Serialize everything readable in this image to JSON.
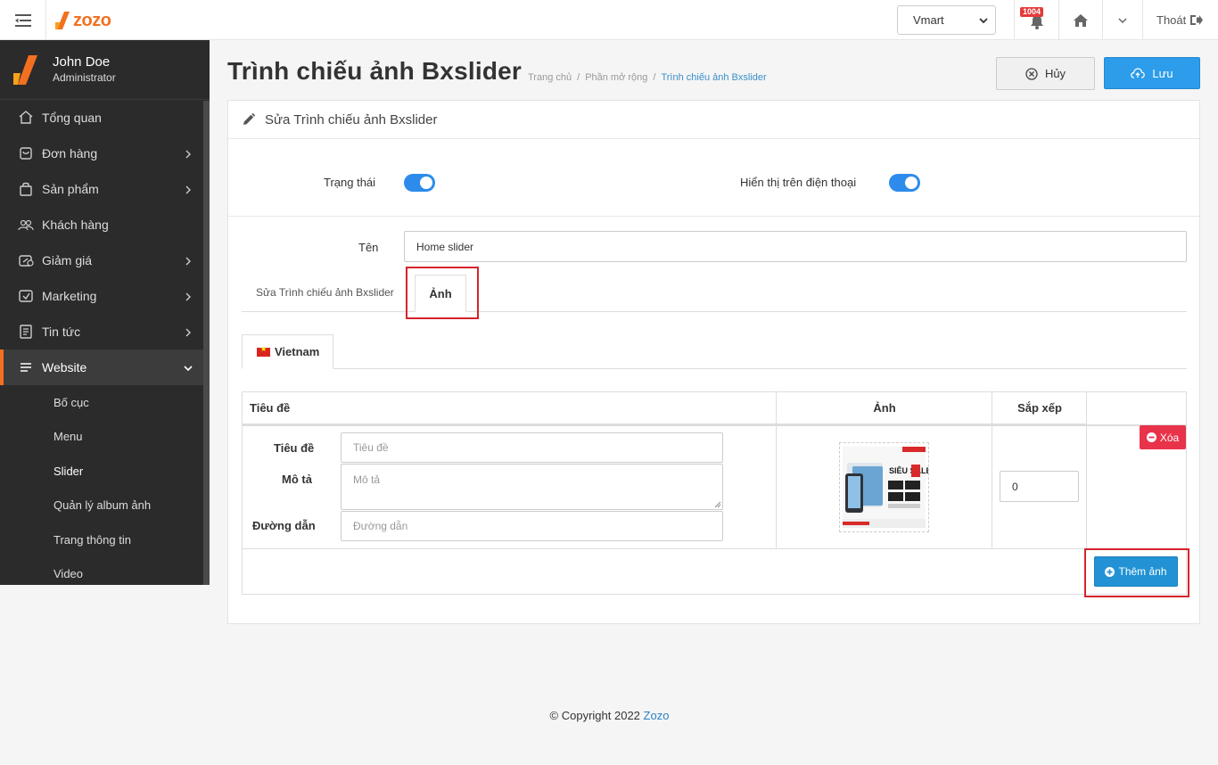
{
  "topbar": {
    "logo_text": "zozo",
    "store_selected": "Vmart",
    "notification_count": "1004",
    "logout_label": "Thoát"
  },
  "sidebar": {
    "user_name": "John Doe",
    "user_role": "Administrator",
    "items": [
      {
        "label": "Tổng quan",
        "icon": "home-icon",
        "has_children": false
      },
      {
        "label": "Đơn hàng",
        "icon": "order-icon",
        "has_children": true
      },
      {
        "label": "Sản phẩm",
        "icon": "bag-icon",
        "has_children": true
      },
      {
        "label": "Khách hàng",
        "icon": "users-icon",
        "has_children": false
      },
      {
        "label": "Giảm giá",
        "icon": "discount-icon",
        "has_children": true
      },
      {
        "label": "Marketing",
        "icon": "marketing-icon",
        "has_children": true
      },
      {
        "label": "Tin tức",
        "icon": "news-icon",
        "has_children": true
      },
      {
        "label": "Website",
        "icon": "list-icon",
        "has_children": true,
        "active": true
      }
    ],
    "sub_items": [
      "Bố cục",
      "Menu",
      "Slider",
      "Quản lý album ảnh",
      "Trang thông tin",
      "Video"
    ],
    "current_sub": "Slider"
  },
  "header": {
    "title": "Trình chiếu ảnh Bxslider",
    "breadcrumb": [
      "Trang chủ",
      "/",
      "Phần mở rộng",
      "/",
      "Trình chiếu ảnh Bxslider"
    ],
    "cancel_label": "Hủy",
    "save_label": "Lưu"
  },
  "panel": {
    "title": "Sửa Trình chiếu ảnh Bxslider",
    "status_label": "Trạng thái",
    "status_on": true,
    "mobile_label": "Hiển thị trên điện thoại",
    "mobile_on": true,
    "name_label": "Tên",
    "name_value": "Home slider",
    "tabs": [
      "Sửa Trình chiếu ảnh Bxslider",
      "Ảnh"
    ],
    "active_tab": "Ảnh",
    "language_tab": "Vietnam"
  },
  "table": {
    "headers": [
      "Tiêu đề",
      "Ảnh",
      "Sắp xếp"
    ],
    "row": {
      "title_label": "Tiêu đề",
      "title_placeholder": "Tiêu đề",
      "desc_label": "Mô tả",
      "desc_placeholder": "Mô tả",
      "link_label": "Đường dẫn",
      "link_placeholder": "Đường dẫn",
      "sort_value": "0",
      "delete_label": "Xóa",
      "banner_text": "SIÊU SALE"
    },
    "add_label": "Thêm ảnh"
  },
  "footer": {
    "copyright": "© Copyright 2022",
    "brand": "Zozo"
  },
  "colors": {
    "accent": "#2d9cea",
    "brand": "#f37021",
    "danger": "#e8334a",
    "sidebar_bg": "#2b2b2b",
    "highlight": "#d6232b"
  }
}
